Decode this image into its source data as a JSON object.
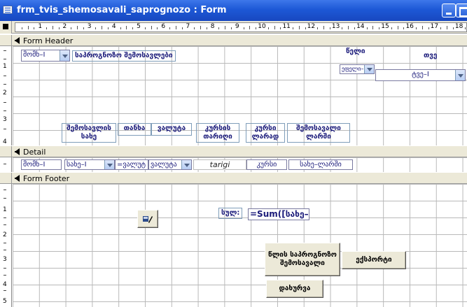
{
  "window": {
    "title": "frm_tvis_shemosavali_saprognozo : Form",
    "minimize_icon": "minimize-icon",
    "maximize_icon": "maximize-icon"
  },
  "ruler": {
    "numbers": [
      "1",
      "2",
      "3",
      "4",
      "5",
      "6",
      "7",
      "8",
      "9",
      "10",
      "11",
      "12",
      "13",
      "14",
      "15",
      "16",
      "17",
      "18"
    ],
    "vertical_header": [
      "1",
      "2",
      "3",
      "4"
    ],
    "vertical_footer": [
      "1",
      "2",
      "3",
      "4",
      "5"
    ]
  },
  "sections": {
    "form_header": "Form Header",
    "detail": "Detail",
    "form_footer": "Form Footer"
  },
  "header": {
    "combo_month": "მომხ–I",
    "title_label": "საპროგნოზო შემოსავლები",
    "label_year": "წელი",
    "label_month": "თვე",
    "combo_year": "ეფელი–",
    "combo_month_right": "ტვე–I",
    "col_headers": [
      "შემოსავლის სახე",
      "თანხა",
      "ვალუტა",
      "კურსის თარიღი",
      "კურსი ლარად",
      "შემოსავალი ლარში"
    ]
  },
  "detail": {
    "field_source": "მომხ–I",
    "field_type": "სახე–I",
    "field_amount_currency": "=ვალუტ",
    "field_currency": "ვალუტა",
    "field_date": "tarigi",
    "field_rate": "კურსი",
    "field_gel": "სახე–ლარში"
  },
  "footer": {
    "sum_label": "სულ:",
    "sum_field": "=Sum([სახე–",
    "btn_year_income": "წლის საპროგნოზო შემოსავალი",
    "btn_export": "ექსპორტი",
    "btn_close": "დახურვა",
    "icon_button": "edit-pencil-icon"
  },
  "colors": {
    "titlebar": "#1d58d6",
    "control_text": "#1a1a7a",
    "grid": "#b9b9b9"
  }
}
